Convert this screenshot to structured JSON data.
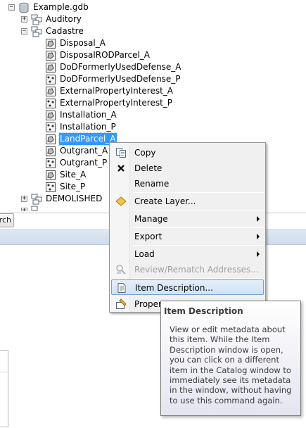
{
  "tree": {
    "root": {
      "label": "Example.gdb"
    },
    "datasets": [
      {
        "label": "Auditory",
        "state": "collapsed"
      },
      {
        "label": "Cadastre",
        "state": "expanded"
      }
    ],
    "cadastre_items": [
      {
        "label": "Disposal_A",
        "kind": "polygon"
      },
      {
        "label": "DisposalRODParcel_A",
        "kind": "polygon"
      },
      {
        "label": "DoDFormerlyUsedDefense_A",
        "kind": "polygon"
      },
      {
        "label": "DoDFormerlyUsedDefense_P",
        "kind": "point"
      },
      {
        "label": "ExternalPropertyInterest_A",
        "kind": "polygon"
      },
      {
        "label": "ExternalPropertyInterest_P",
        "kind": "point"
      },
      {
        "label": "Installation_A",
        "kind": "polygon"
      },
      {
        "label": "Installation_P",
        "kind": "point"
      },
      {
        "label": "LandParcel_A",
        "kind": "polygon",
        "selected": true
      },
      {
        "label": "Outgrant_A",
        "kind": "polygon"
      },
      {
        "label": "Outgrant_P",
        "kind": "point"
      },
      {
        "label": "Site_A",
        "kind": "polygon"
      },
      {
        "label": "Site_P",
        "kind": "point"
      }
    ],
    "after": [
      {
        "label": "DEMOLISHED",
        "state": "collapsed"
      }
    ]
  },
  "search": {
    "button_label": "rch"
  },
  "context_menu": {
    "items": [
      {
        "label": "Copy",
        "icon": "copy-icon"
      },
      {
        "label": "Delete",
        "icon": "delete-x-icon"
      },
      {
        "label": "Rename",
        "icon": ""
      },
      {
        "label": "Create Layer...",
        "icon": "layer-diamond-icon"
      },
      {
        "label": "Manage",
        "submenu": true
      },
      {
        "label": "Export",
        "submenu": true
      },
      {
        "label": "Load",
        "submenu": true
      },
      {
        "label": "Review/Rematch Addresses...",
        "icon": "review-addresses-icon",
        "disabled": true
      },
      {
        "label": "Item Description...",
        "icon": "document-icon",
        "highlighted": true
      },
      {
        "label": "Proper",
        "icon": "properties-icon"
      }
    ]
  },
  "tooltip": {
    "title": "Item Description",
    "body": "View or edit metadata about this item. While the Item Description window is open, you can click on a different item in the Catalog window to immediately see its metadata in the window, without having to use this command again."
  },
  "colors": {
    "selection": "#3399ff",
    "menu_highlight_border": "#6fa3d6",
    "menu_bg": "#f0f0f0",
    "tooltip_border": "#767676"
  }
}
